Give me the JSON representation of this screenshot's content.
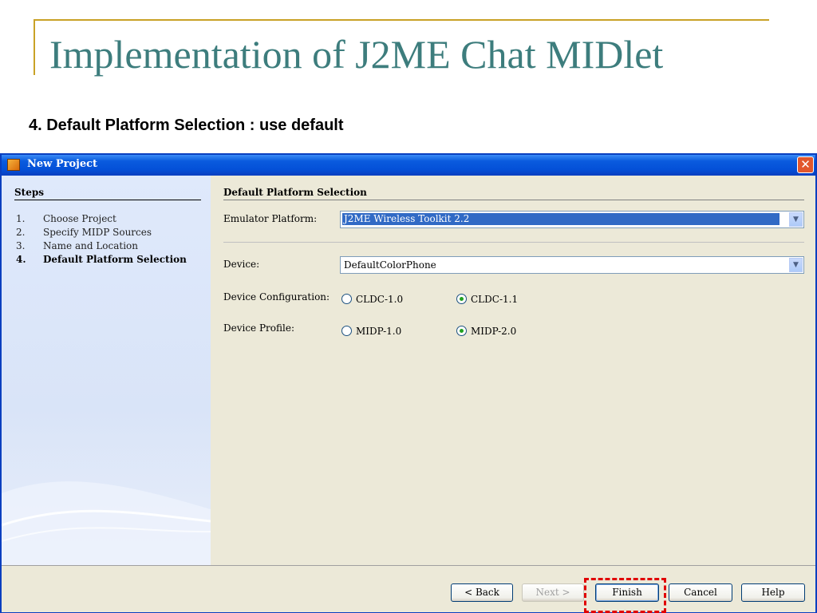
{
  "slide": {
    "title": "Implementation of J2ME Chat MIDlet",
    "subtitle": "4. Default Platform Selection : use default"
  },
  "window": {
    "title": "New Project",
    "close_glyph": "✕"
  },
  "steps": {
    "heading": "Steps",
    "items": [
      {
        "num": "1.",
        "label": "Choose Project",
        "active": false
      },
      {
        "num": "2.",
        "label": "Specify MIDP Sources",
        "active": false
      },
      {
        "num": "3.",
        "label": "Name and Location",
        "active": false
      },
      {
        "num": "4.",
        "label": "Default Platform Selection",
        "active": true
      }
    ]
  },
  "form": {
    "heading": "Default Platform Selection",
    "emulator": {
      "label": "Emulator Platform:",
      "value": "J2ME Wireless Toolkit 2.2"
    },
    "device": {
      "label": "Device:",
      "value": "DefaultColorPhone"
    },
    "configuration": {
      "label": "Device Configuration:",
      "options": [
        "CLDC-1.0",
        "CLDC-1.1"
      ],
      "selected": "CLDC-1.1"
    },
    "profile": {
      "label": "Device Profile:",
      "options": [
        "MIDP-1.0",
        "MIDP-2.0"
      ],
      "selected": "MIDP-2.0"
    },
    "dropdown_glyph": "▼"
  },
  "buttons": {
    "back": "< Back",
    "next": "Next >",
    "finish": "Finish",
    "cancel": "Cancel",
    "help": "Help"
  },
  "colors": {
    "titlebar": "#0a5bde",
    "highlight_box": "#e00000",
    "slide_title": "#3d7d7d",
    "accent_line": "#c9a227"
  }
}
